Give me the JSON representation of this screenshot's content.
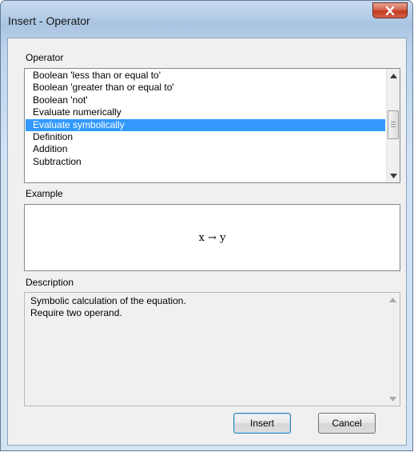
{
  "window": {
    "title": "Insert - Operator"
  },
  "operator": {
    "label": "Operator",
    "items": [
      "Boolean 'less than or equal to'",
      "Boolean 'greater than or equal to'",
      "Boolean 'not'",
      "Evaluate numerically",
      "Evaluate symbolically",
      "Definition",
      "Addition",
      "Subtraction"
    ],
    "selected_index": 4
  },
  "example": {
    "label": "Example",
    "expression": "x → y"
  },
  "description": {
    "label": "Description",
    "lines": [
      "Symbolic calculation of the equation.",
      "Require two operand."
    ]
  },
  "buttons": {
    "insert": "Insert",
    "cancel": "Cancel"
  },
  "icons": {
    "close": "close-icon",
    "up": "scroll-up-arrow-icon",
    "down": "scroll-down-arrow-icon"
  },
  "colors": {
    "selection": "#3399ff",
    "titlebar": "#bcd3ec",
    "close": "#c2391f"
  }
}
